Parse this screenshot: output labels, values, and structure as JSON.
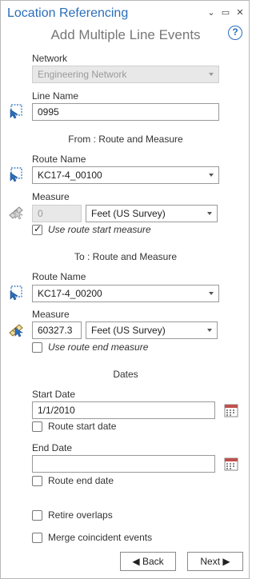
{
  "window": {
    "title": "Location Referencing",
    "subtitle": "Add Multiple Line Events",
    "help_label": "?",
    "controls": {
      "dropdown": "⌄",
      "maximize": "▭",
      "close": "✕"
    }
  },
  "network": {
    "label": "Network",
    "value": "Engineering Network",
    "enabled": false
  },
  "line_name": {
    "label": "Line Name",
    "value": "0995"
  },
  "from": {
    "section_label": "From : Route and Measure",
    "route_label": "Route Name",
    "route_value": "KC17-4_00100",
    "measure_label": "Measure",
    "measure_value": "0",
    "measure_enabled": false,
    "units_value": "Feet (US Survey)",
    "checkbox_label": "Use route start measure",
    "checkbox_checked": true
  },
  "to": {
    "section_label": "To : Route and Measure",
    "route_label": "Route Name",
    "route_value": "KC17-4_00200",
    "measure_label": "Measure",
    "measure_value": "60327.3",
    "units_value": "Feet (US Survey)",
    "checkbox_label": "Use route end measure",
    "checkbox_checked": false
  },
  "dates": {
    "section_label": "Dates",
    "start_label": "Start Date",
    "start_value": "1/1/2010",
    "start_checkbox_label": "Route start date",
    "end_label": "End Date",
    "end_value": "",
    "end_checkbox_label": "Route end date"
  },
  "options": {
    "retire_overlaps": "Retire overlaps",
    "merge_coincident": "Merge coincident events"
  },
  "buttons": {
    "back": "◀ Back",
    "next": "Next ▶"
  },
  "colors": {
    "title": "#2a6ebb",
    "subtitle": "#777777",
    "border": "#b8b8b8"
  },
  "icons": {
    "line_picker": "select-line-tool-icon",
    "route_picker": "select-route-tool-icon",
    "measure_picker": "select-measure-tool-icon",
    "calendar": "calendar-icon"
  }
}
